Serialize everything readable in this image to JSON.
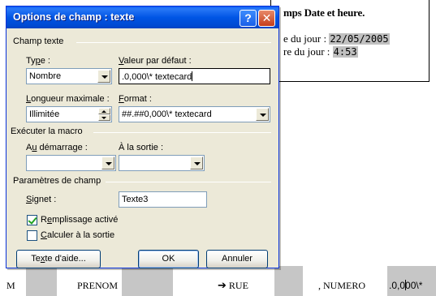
{
  "document": {
    "heading": "mps Date et heure.",
    "line1_label": "e du jour : ",
    "line1_value": "22/05/2005",
    "line2_label": "re du jour : ",
    "line2_value": "4:53",
    "bottom": {
      "left_fragment": "M",
      "prenom": "PRENOM",
      "arrow": "➔",
      "rue": "RUE",
      "numero": ", NUMERO",
      "field_start": ".0,0",
      "field_end": "00\\*"
    }
  },
  "dialog": {
    "title": "Options de champ : texte",
    "help_glyph": "?",
    "close_glyph": "✕",
    "champ_texte": {
      "section": "Champ texte",
      "type_label_pre": "Ty",
      "type_label_u": "p",
      "type_label_post": "e :",
      "type_value": "Nombre",
      "default_label_pre": "",
      "default_label_u": "V",
      "default_label_post": "aleur par défaut :",
      "default_value": ".0,000\\* textecard",
      "maxlen_label_pre": "",
      "maxlen_label_u": "L",
      "maxlen_label_post": "ongueur maximale :",
      "maxlen_value": "Illimitée",
      "format_label_pre": "",
      "format_label_u": "F",
      "format_label_post": "ormat :",
      "format_value": "##.##0,000\\* textecard"
    },
    "macro": {
      "section": "Exécuter la macro",
      "on_entry_pre": "A",
      "on_entry_u": "u",
      "on_entry_post": " démarrage :",
      "on_entry_value": "",
      "on_exit_label": "À la sortie :",
      "on_exit_value": ""
    },
    "params": {
      "section": "Paramètres de champ",
      "bookmark_pre": "",
      "bookmark_u": "S",
      "bookmark_post": "ignet :",
      "bookmark_value": "Texte3",
      "fill_pre": "R",
      "fill_u": "e",
      "fill_post": "mplissage activé",
      "fill_checked": true,
      "calc_pre": "",
      "calc_u": "C",
      "calc_post": "alculer à la sortie",
      "calc_checked": false
    },
    "buttons": {
      "help_pre": "Te",
      "help_u": "x",
      "help_post": "te d'aide...",
      "ok": "OK",
      "cancel": "Annuler"
    }
  }
}
